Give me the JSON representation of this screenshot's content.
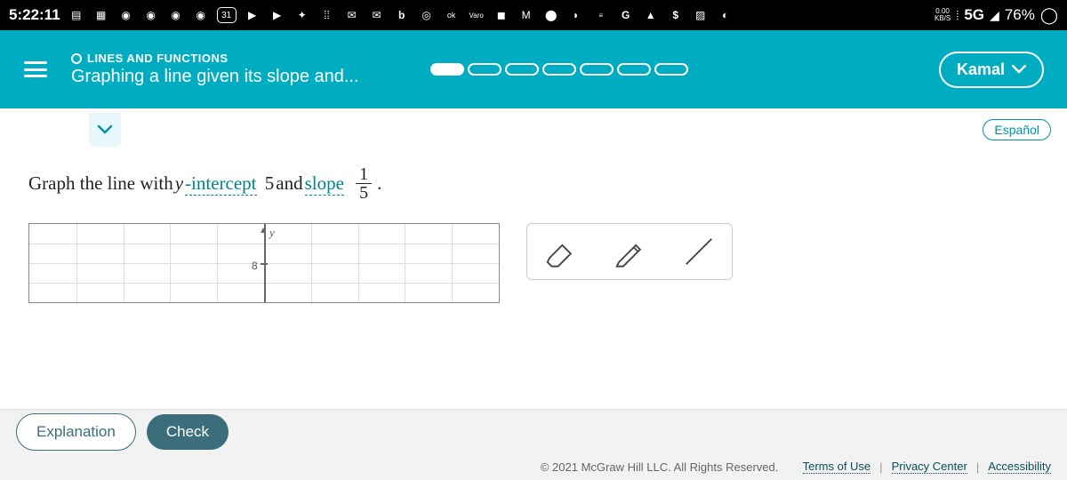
{
  "status": {
    "time": "5:22:11",
    "kbps_value": "0.00",
    "kbps_unit": "KB/S",
    "network": "5G",
    "battery": "76%",
    "calendar": "31",
    "varo": "Varo"
  },
  "header": {
    "eyebrow": "LINES AND FUNCTIONS",
    "title": "Graphing a line given its slope and...",
    "user": "Kamal"
  },
  "content": {
    "language": "Español",
    "prompt_prefix": "Graph the line with ",
    "y_var": "y",
    "intercept_word": "-intercept",
    "intercept_val": "5",
    "and_word": " and ",
    "slope_word": "slope",
    "frac_num": "1",
    "frac_den": "5",
    "period": ".",
    "axis_y_label": "y",
    "tick_8": "8"
  },
  "actions": {
    "explanation": "Explanation",
    "check": "Check"
  },
  "footer": {
    "copyright": "© 2021 McGraw Hill LLC. All Rights Reserved.",
    "terms": "Terms of Use",
    "privacy": "Privacy Center",
    "accessibility": "Accessibility"
  }
}
